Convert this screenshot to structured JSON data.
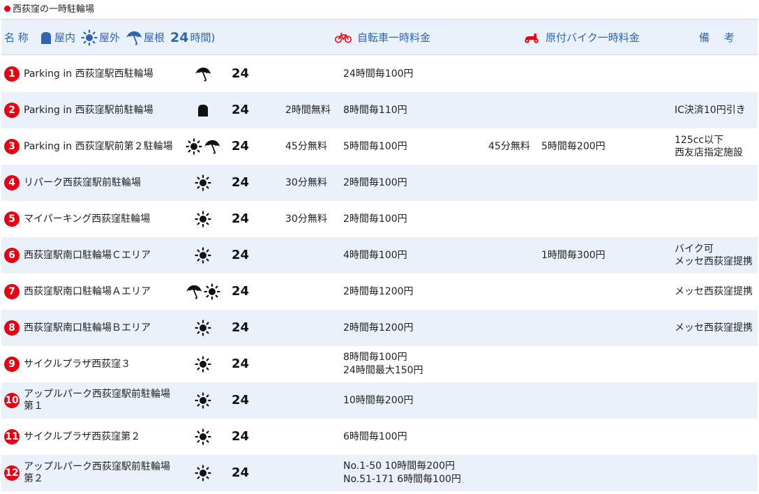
{
  "title": "西荻窪の一時駐輪場",
  "header": {
    "name": "名 称",
    "indoor": "屋内",
    "outdoor": "屋外",
    "roof": "屋根",
    "h24": "24",
    "h24_suffix": "時間)",
    "bike_fee": "自転車一時料金",
    "moto_fee": "原付バイク一時料金",
    "notes": "備 考"
  },
  "colors": {
    "accent": "#2e64b0",
    "number_badge": "#e60012",
    "alt_row": "#eaf1fa"
  },
  "rows": [
    {
      "num": "1",
      "name": "Parking in 西荻窪駅西駐輪場",
      "icons": [
        "umbrella-icon"
      ],
      "h24": "24",
      "bike_free": "",
      "bike_fee": [
        "24時間毎100円"
      ],
      "moto_free": "",
      "moto_fee": "",
      "notes": []
    },
    {
      "num": "2",
      "name": "Parking in 西荻窪駅前駐輪場",
      "icons": [
        "indoor-icon"
      ],
      "h24": "24",
      "bike_free": "2時間無料",
      "bike_fee": [
        "8時間毎110円"
      ],
      "moto_free": "",
      "moto_fee": "",
      "notes": [
        "IC決済10円引き"
      ]
    },
    {
      "num": "3",
      "name": "Parking in 西荻窪駅前第２駐輪場",
      "icons": [
        "sun-icon",
        "umbrella-icon"
      ],
      "h24": "24",
      "bike_free": "45分無料",
      "bike_fee": [
        "5時間毎100円"
      ],
      "moto_free": "45分無料",
      "moto_fee": "5時間毎200円",
      "notes": [
        "125cc以下",
        "西友店指定施設"
      ]
    },
    {
      "num": "4",
      "name": "リパーク西荻窪駅前駐輪場",
      "icons": [
        "sun-icon"
      ],
      "h24": "24",
      "bike_free": "30分無料",
      "bike_fee": [
        "2時間毎100円"
      ],
      "moto_free": "",
      "moto_fee": "",
      "notes": []
    },
    {
      "num": "5",
      "name": "マイパーキング西荻窪駐輪場",
      "icons": [
        "sun-icon"
      ],
      "h24": "24",
      "bike_free": "30分無料",
      "bike_fee": [
        "2時間毎100円"
      ],
      "moto_free": "",
      "moto_fee": "",
      "notes": []
    },
    {
      "num": "6",
      "name": "西荻窪駅南口駐輪場Ｃエリア",
      "icons": [
        "sun-icon"
      ],
      "h24": "24",
      "bike_free": "",
      "bike_fee": [
        "4時間毎100円"
      ],
      "moto_free": "",
      "moto_fee": "1時間毎300円",
      "notes": [
        "バイク可",
        "メッセ西荻窪提携"
      ]
    },
    {
      "num": "7",
      "name": "西荻窪駅南口駐輪場Ａエリア",
      "icons": [
        "umbrella-icon",
        "sun-icon"
      ],
      "h24": "24",
      "bike_free": "",
      "bike_fee": [
        "2時間毎1200円"
      ],
      "moto_free": "",
      "moto_fee": "",
      "notes": [
        "メッセ西荻窪提携"
      ]
    },
    {
      "num": "8",
      "name": "西荻窪駅南口駐輪場Ｂエリア",
      "icons": [
        "sun-icon"
      ],
      "h24": "24",
      "bike_free": "",
      "bike_fee": [
        "2時間毎1200円"
      ],
      "moto_free": "",
      "moto_fee": "",
      "notes": [
        "メッセ西荻窪提携"
      ]
    },
    {
      "num": "9",
      "name": "サイクルプラザ西荻窪３",
      "icons": [
        "sun-icon"
      ],
      "h24": "24",
      "bike_free": "",
      "bike_fee": [
        "8時間毎100円",
        "24時間最大150円"
      ],
      "moto_free": "",
      "moto_fee": "",
      "notes": []
    },
    {
      "num": "10",
      "name": "アップルパーク西荻窪駅前駐輪場第１",
      "icons": [
        "sun-icon"
      ],
      "h24": "24",
      "bike_free": "",
      "bike_fee": [
        "10時間毎200円"
      ],
      "moto_free": "",
      "moto_fee": "",
      "notes": []
    },
    {
      "num": "11",
      "name": "サイクルプラザ西荻窪第２",
      "icons": [
        "sun-icon"
      ],
      "h24": "24",
      "bike_free": "",
      "bike_fee": [
        "6時間毎100円"
      ],
      "moto_free": "",
      "moto_fee": "",
      "notes": []
    },
    {
      "num": "12",
      "name": "アップルパーク西荻窪駅前駐輪場第２",
      "icons": [
        "sun-icon"
      ],
      "h24": "24",
      "bike_free": "",
      "bike_fee": [
        "No.1-50 10時間毎200円",
        "No.51-171 6時間毎100円"
      ],
      "moto_free": "",
      "moto_fee": "",
      "notes": []
    }
  ]
}
